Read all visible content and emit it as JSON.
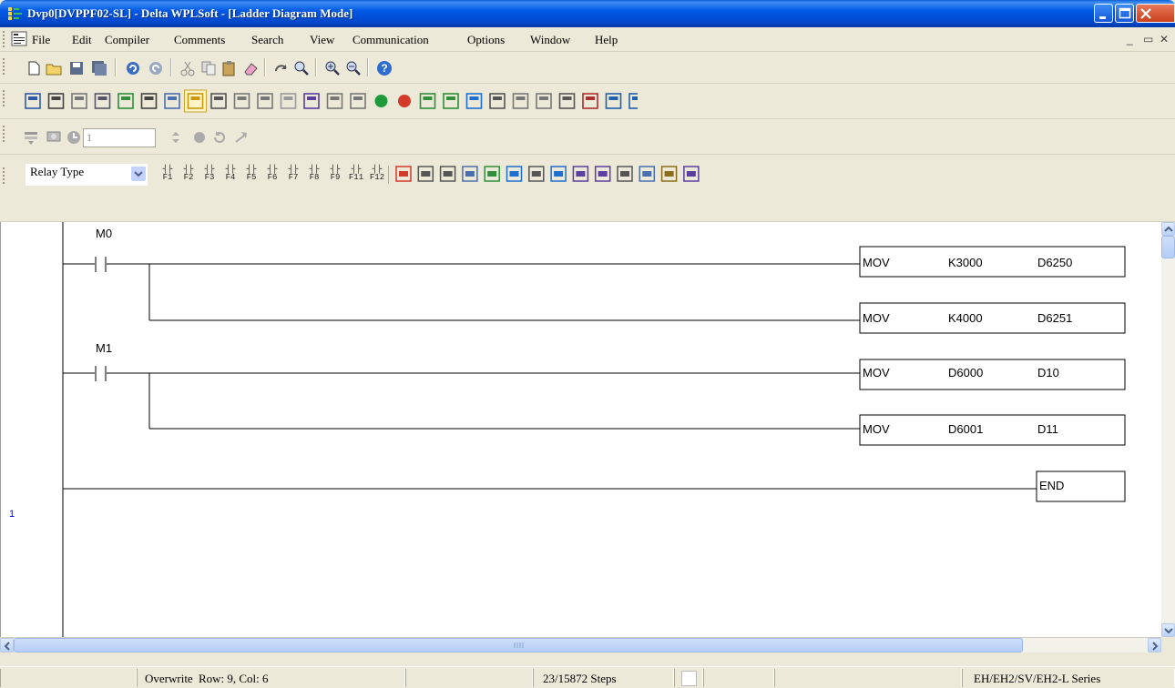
{
  "window": {
    "title": "Dvp0[DVPPF02-SL] - Delta WPLSoft - [Ladder Diagram Mode]"
  },
  "menu": {
    "items": [
      "File",
      "Edit",
      "Compiler",
      "Comments",
      "Search",
      "View",
      "Communication",
      "Options",
      "Window",
      "Help"
    ]
  },
  "toolbar": {
    "step_value": "1",
    "relay_type": "Relay Type",
    "function_keys": [
      "F1",
      "F2",
      "F3",
      "F4",
      "F5",
      "F6",
      "F7",
      "F8",
      "F9",
      "F11",
      "F12"
    ]
  },
  "ladder": {
    "rungs": [
      {
        "contact": "M0",
        "instructions": [
          {
            "op": "MOV",
            "src": "K3000",
            "dst": "D6250"
          },
          {
            "op": "MOV",
            "src": "K4000",
            "dst": "D6251"
          }
        ]
      },
      {
        "contact": "M1",
        "instructions": [
          {
            "op": "MOV",
            "src": "D6000",
            "dst": "D10"
          },
          {
            "op": "MOV",
            "src": "D6001",
            "dst": "D11"
          }
        ]
      }
    ],
    "end_label": "END",
    "row_marker": "1"
  },
  "statusbar": {
    "mode": "Overwrite",
    "position": "Row: 9, Col: 6",
    "steps": "23/15872 Steps",
    "series": "EH/EH2/SV/EH2-L Series"
  },
  "colors": {
    "titlebar": "#0054e3",
    "chrome": "#ece9d8",
    "ladder_bg": "#ffffff",
    "scrollbar": "#bcd2f7"
  }
}
